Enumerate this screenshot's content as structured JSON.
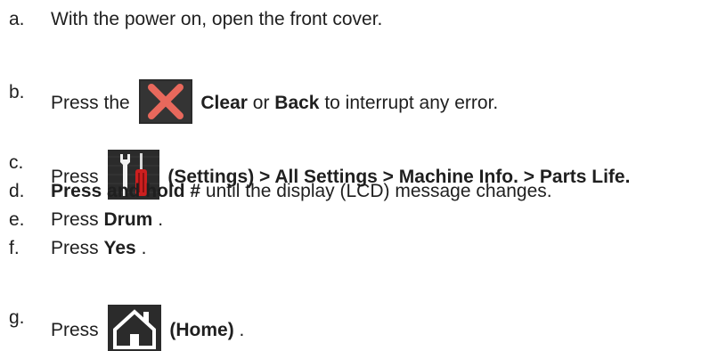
{
  "steps": [
    {
      "marker": "a.",
      "parts": [
        {
          "text": "With the power on, open the front cover."
        }
      ]
    },
    {
      "marker": "b.",
      "parts": [
        {
          "text": "Press the "
        },
        {
          "icon": "clear-icon"
        },
        {
          "text": " Clear",
          "bold": true
        },
        {
          "text": " or "
        },
        {
          "text": "Back",
          "bold": true
        },
        {
          "text": " to interrupt any error."
        }
      ]
    },
    {
      "marker": "c.",
      "parts": [
        {
          "text": "Press "
        },
        {
          "icon": "settings-icon"
        },
        {
          "text": " (Settings) > All Settings > Machine Info. > Parts Life.",
          "bold": true
        }
      ]
    },
    {
      "marker": "d.",
      "parts": [
        {
          "text": "Press and hold #",
          "bold": true
        },
        {
          "text": " until the display (LCD) message changes."
        }
      ]
    },
    {
      "marker": "e.",
      "parts": [
        {
          "text": "Press "
        },
        {
          "text": "Drum",
          "bold": true
        },
        {
          "text": "."
        }
      ]
    },
    {
      "marker": "f.",
      "parts": [
        {
          "text": "Press "
        },
        {
          "text": "Yes",
          "bold": true
        },
        {
          "text": "."
        }
      ]
    },
    {
      "marker": "g.",
      "parts": [
        {
          "text": "Press "
        },
        {
          "icon": "home-icon"
        },
        {
          "text": " (Home)",
          "bold": true
        },
        {
          "text": "."
        }
      ]
    }
  ],
  "colors": {
    "text": "#1f1f1f",
    "icon_background": "#2b2b2b",
    "clear_x": "#e8685c",
    "screwdriver_handle": "#cc1f1f",
    "home_outline": "#ffffff"
  }
}
